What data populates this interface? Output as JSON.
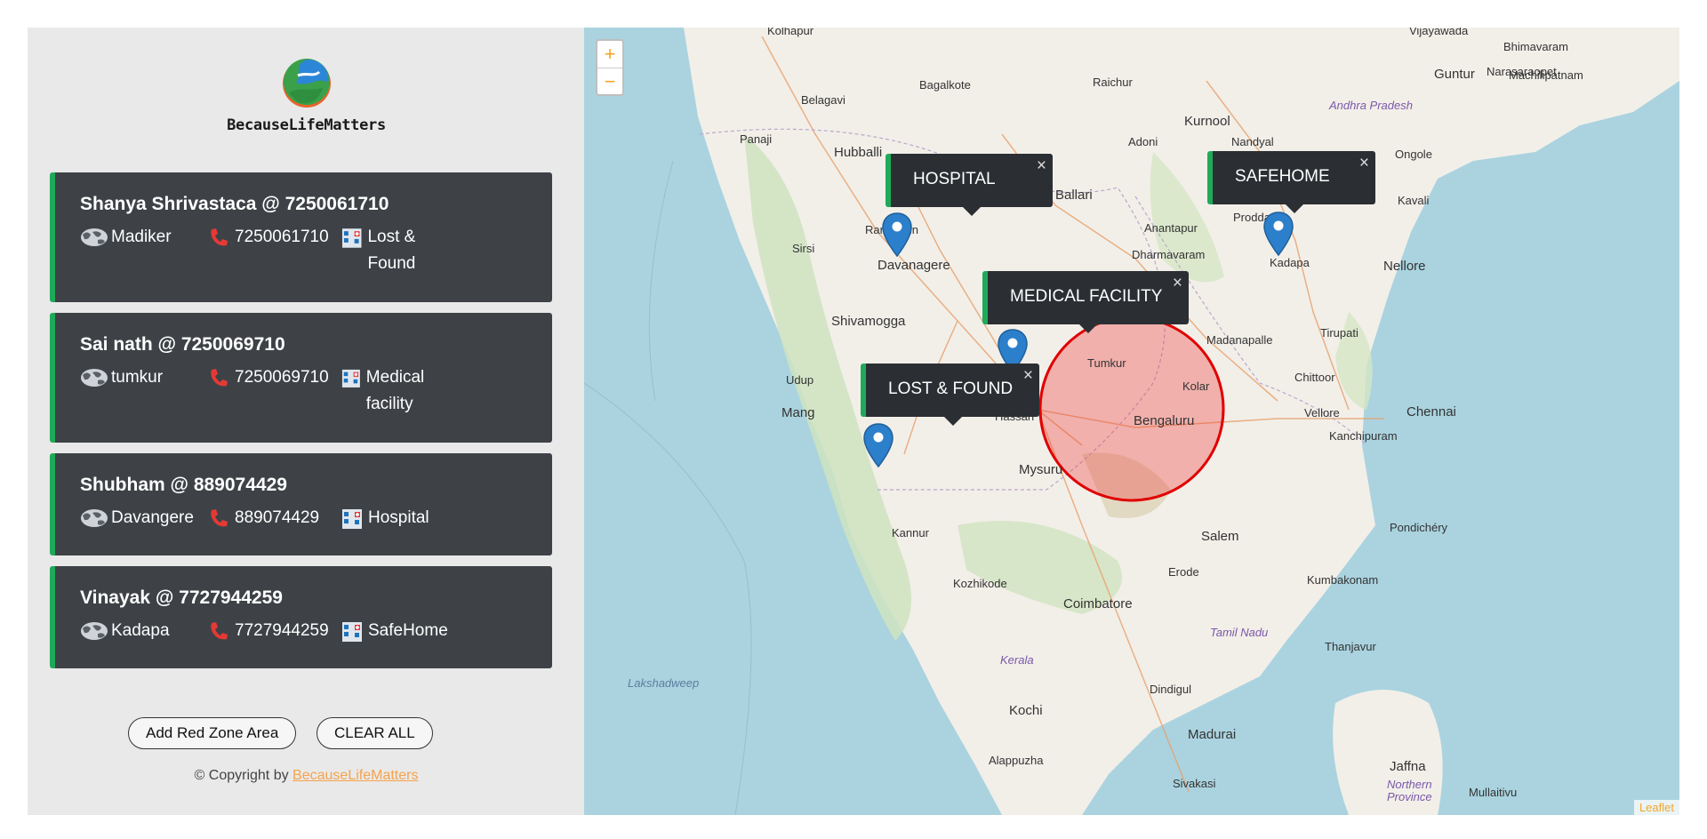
{
  "brand": {
    "name": "BecauseLifeMatters"
  },
  "reports": [
    {
      "title": "Shanya Shrivastaca @ 7250061710",
      "location": "Madiker",
      "phone": "7250061710",
      "category": "Lost & Found"
    },
    {
      "title": "Sai nath @ 7250069710",
      "location": "tumkur",
      "phone": "7250069710",
      "category": "Medical facility"
    },
    {
      "title": "Shubham @ 889074429",
      "location": "Davangere",
      "phone": "889074429",
      "category": "Hospital"
    },
    {
      "title": "Vinayak @ 7727944259",
      "location": "Kadapa",
      "phone": "7727944259",
      "category": "SafeHome"
    }
  ],
  "actions": {
    "add_red_zone": "Add Red Zone Area",
    "clear_all": "CLEAR ALL"
  },
  "footer": {
    "prefix": "© Copyright by",
    "link": "BecauseLifeMatters"
  },
  "map": {
    "zoom_in": "+",
    "zoom_out": "−",
    "attribution": "Leaflet",
    "popups": [
      {
        "label": "HOSPITAL",
        "close": "×"
      },
      {
        "label": "SAFEHOME",
        "close": "×"
      },
      {
        "label": "MEDICAL FACILITY",
        "close": "×"
      },
      {
        "label": "LOST & FOUND",
        "close": "×"
      }
    ],
    "places": {
      "kolhapur": "Kolhapur",
      "vijayawada": "Vijayawada",
      "bhimavaram": "Bhimavaram",
      "bagalkote": "Bagalkote",
      "raichur": "Raichur",
      "belagavi": "Belagavi",
      "kurnool": "Kurnool",
      "narasaraopet": "Narasaraopet",
      "guntur": "Guntur",
      "machilipatnam": "Machilipatnam",
      "andhra_pradesh": "Andhra Pradesh",
      "panaji": "Panaji",
      "hubballi": "Hubballi",
      "adoni": "Adoni",
      "nandyal": "Nandyal",
      "ongole": "Ongole",
      "ballari": "Ballari",
      "ranebennuru": "Ranebenn",
      "sirsi": "Sirsi",
      "anantapur": "Anantapur",
      "proddatur": "Proddatu",
      "kavali": "Kavali",
      "davanagere": "Davanagere",
      "dharmavaram": "Dharmavaram",
      "kadapa": "Kadapa",
      "nellore": "Nellore",
      "shivamogga": "Shivamogga",
      "madanapalle": "Madanapalle",
      "tirupati": "Tirupati",
      "udupi": "Udup",
      "tumkur": "Tumkur",
      "kolar": "Kolar",
      "chittoor": "Chittoor",
      "mangaluru": "Mang",
      "hassan": "Hassan",
      "bengaluru": "Bengaluru",
      "vellore": "Vellore",
      "chennai": "Chennai",
      "kanchipuram": "Kanchipuram",
      "mysuru": "Mysuru",
      "kannur": "Kannur",
      "salem": "Salem",
      "pondicherry": "Pondichéry",
      "kozhikode": "Kozhikode",
      "erode": "Erode",
      "coimbatore": "Coimbatore",
      "kumbakonam": "Kumbakonam",
      "tamil_nadu": "Tamil Nadu",
      "kerala": "Kerala",
      "thanjavur": "Thanjavur",
      "lakshadweep": "Lakshadweep",
      "dindigul": "Dindigul",
      "kochi": "Kochi",
      "madurai": "Madurai",
      "jaffna": "Jaffna",
      "alappuzha": "Alappuzha",
      "sivakasi": "Sivakasi",
      "northern_province": "Northern\nProvince",
      "mullaitivu": "Mullaitivu"
    }
  },
  "colors": {
    "accent_green": "#1faa59",
    "card_bg": "#3e4247",
    "red_zone": "#e00000",
    "link_orange": "#f5a34c"
  },
  "icons": {
    "location": "globe-icon",
    "phone": "phone-icon",
    "category": "building-icon",
    "pin": "map-pin-icon"
  }
}
